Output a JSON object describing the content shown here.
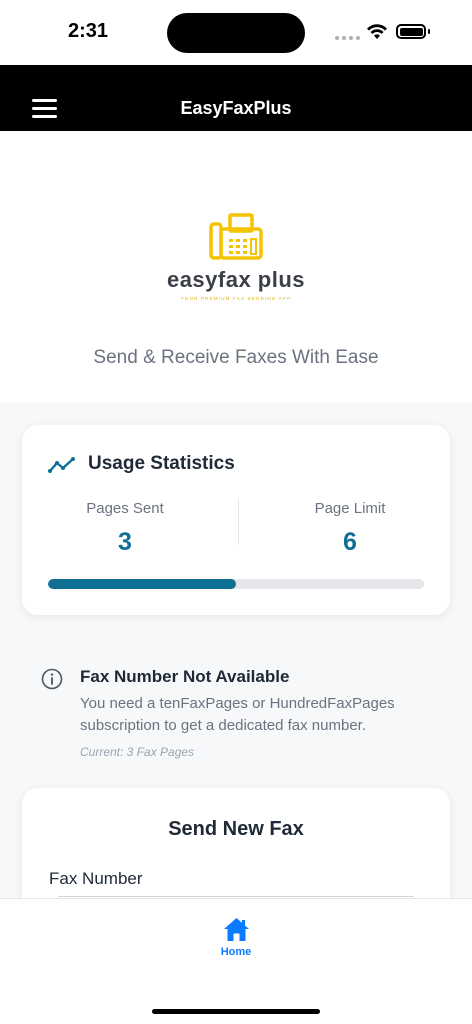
{
  "status_bar": {
    "time": "2:31"
  },
  "nav": {
    "title": "EasyFaxPlus"
  },
  "hero": {
    "logo_text": "easyfax plus",
    "logo_tagline": "YOUR PREMIUM FAX SENDING APP",
    "subtitle": "Send & Receive Faxes With Ease"
  },
  "usage": {
    "title": "Usage Statistics",
    "pages_sent_label": "Pages Sent",
    "pages_sent": "3",
    "page_limit_label": "Page Limit",
    "page_limit": "6",
    "progress_fraction": 0.5
  },
  "notice": {
    "title": "Fax Number Not Available",
    "text": "You need a tenFaxPages or HundredFaxPages subscription to get a dedicated fax number.",
    "current": "Current: 3 Fax Pages"
  },
  "send_fax": {
    "title": "Send New Fax",
    "fax_number_label": "Fax Number"
  },
  "tab_bar": {
    "home_label": "Home"
  },
  "colors": {
    "accent": "#0f6f94",
    "logo_yellow": "#f5c400",
    "tab_active": "#0a7aff",
    "nav_bg": "#000000"
  },
  "icons": {
    "menu": "hamburger-icon",
    "logo": "fax-machine-icon",
    "usage": "trend-line-icon",
    "notice": "info-circle-icon",
    "home": "home-icon"
  }
}
